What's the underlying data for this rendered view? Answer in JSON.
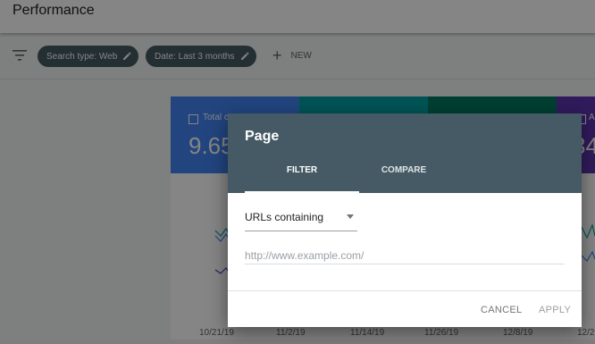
{
  "header": {
    "title": "Performance"
  },
  "filters": {
    "chips": [
      {
        "label": "Search type: Web"
      },
      {
        "label": "Date: Last 3 months"
      }
    ],
    "new_label": "NEW"
  },
  "metrics": [
    {
      "label": "Total c",
      "value": "9.65",
      "color": "#4285f4",
      "checked": true
    },
    {
      "label": "",
      "value": "",
      "color": "#00a2a6"
    },
    {
      "label": "",
      "value": "",
      "color": "#007a63"
    },
    {
      "label": "A",
      "value": "34",
      "color": "#5e35b1",
      "checked": true
    }
  ],
  "chart": {
    "x_ticks": [
      "10/21/19",
      "11/2/19",
      "11/14/19",
      "11/26/19",
      "12/8/19",
      "12/2"
    ]
  },
  "dialog": {
    "title": "Page",
    "tabs": [
      {
        "label": "FILTER",
        "active": true
      },
      {
        "label": "COMPARE",
        "active": false
      }
    ],
    "select": {
      "value": "URLs containing"
    },
    "url_input": {
      "placeholder": "http://www.example.com/",
      "value": ""
    },
    "buttons": {
      "cancel": "CANCEL",
      "apply": "APPLY"
    }
  }
}
